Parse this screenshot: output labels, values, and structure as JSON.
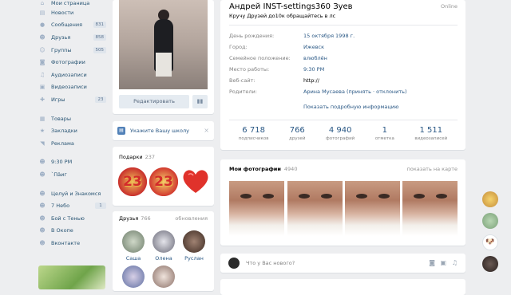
{
  "sidebar": {
    "items": [
      {
        "label": "Мои страница",
        "icon": "home-icon",
        "count": ""
      },
      {
        "label": "Новости",
        "icon": "news-icon",
        "count": ""
      },
      {
        "label": "Сообщения",
        "icon": "messages-icon",
        "count": "831"
      },
      {
        "label": "Друзья",
        "icon": "friends-icon",
        "count": "858"
      },
      {
        "label": "Группы",
        "icon": "groups-icon",
        "count": "505"
      },
      {
        "label": "Фотографии",
        "icon": "camera-icon",
        "count": ""
      },
      {
        "label": "Аудиозаписи",
        "icon": "music-icon",
        "count": ""
      },
      {
        "label": "Видеозаписи",
        "icon": "video-icon",
        "count": ""
      },
      {
        "label": "Игры",
        "icon": "games-icon",
        "count": "23"
      }
    ],
    "items2": [
      {
        "label": "Товары",
        "icon": "bag-icon"
      },
      {
        "label": "Закладки",
        "icon": "star-icon"
      },
      {
        "label": "Реклама",
        "icon": "megaphone-icon"
      }
    ],
    "items3": [
      {
        "label": "9:30 PM",
        "icon": "group-icon"
      },
      {
        "label": "`Пäиг",
        "icon": "group-icon"
      }
    ],
    "items4": [
      {
        "label": "Целуй и Знакомся",
        "icon": "group-icon",
        "count": ""
      },
      {
        "label": "7 Небо",
        "icon": "group-icon",
        "count": "1"
      },
      {
        "label": "Бой с Тенью",
        "icon": "group-icon",
        "count": ""
      },
      {
        "label": "В Окопе",
        "icon": "group-icon",
        "count": ""
      },
      {
        "label": "Вконтакте",
        "icon": "group-icon",
        "count": ""
      }
    ]
  },
  "photo_card": {
    "edit_label": "Редактировать"
  },
  "school": {
    "label": "Укажите Вашу школу"
  },
  "gifts": {
    "title": "Подарки",
    "count": "237",
    "gift1": "23",
    "gift2": "23"
  },
  "friends": {
    "title": "Друзья",
    "count": "766",
    "update": "обновления",
    "list": [
      {
        "name": "Саша"
      },
      {
        "name": "Олена"
      },
      {
        "name": "Руслан"
      }
    ]
  },
  "profile": {
    "name": "Андрей INST-settings360 Зуев",
    "online": "Online",
    "status": "Кручу Друзей до10к обращайтесь в лс",
    "birthday_k": "День рождения:",
    "birthday_v": "15 октября 1998 г.",
    "city_k": "Город:",
    "city_v": "Ижевск",
    "marital_k": "Семейное положение:",
    "marital_v": "влюблён",
    "work_k": "Место работы:",
    "work_v": "9:30 PM",
    "web_k": "Веб-сайт:",
    "web_v": "http://",
    "parents_k": "Родители:",
    "parents_v": "Арина Мусаева (принять · отклонить)",
    "more": "Показать подробную информацию"
  },
  "counters": [
    {
      "n": "6 718",
      "l": "подписчиков"
    },
    {
      "n": "766",
      "l": "друзей"
    },
    {
      "n": "4 940",
      "l": "фотографий"
    },
    {
      "n": "1",
      "l": "отметка"
    },
    {
      "n": "1 511",
      "l": "видеозаписей"
    }
  ],
  "photos": {
    "title": "Мои фотографии",
    "count": "4940",
    "map": "показать на карте"
  },
  "post": {
    "placeholder": "Что у Вас нового?"
  }
}
